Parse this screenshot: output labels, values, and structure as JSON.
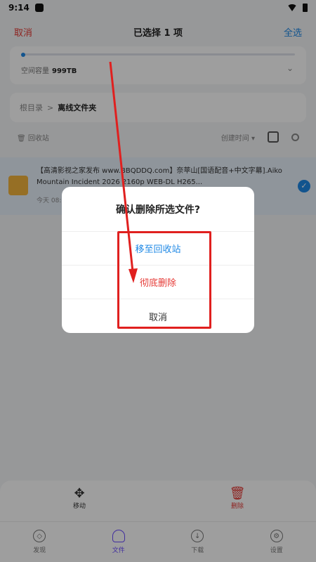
{
  "status": {
    "time": "9:14"
  },
  "topbar": {
    "cancel": "取消",
    "title": "已选择 1 项",
    "select_all": "全选"
  },
  "storage": {
    "label": "空间容量",
    "value": "999TB",
    "progress_percent": 1
  },
  "breadcrumb": {
    "root": "根目录",
    "separator": ">",
    "current": "离线文件夹"
  },
  "toolbar": {
    "recycle": "回收站",
    "sort": "创建时间"
  },
  "file": {
    "name": "【高清影视之家发布 www.BBQDDQ.com】奈苹山[国语配音+中文字幕].Aiko Mountain Incident 2026 2160p WEB-DL H265...",
    "meta": "今天 08:"
  },
  "actions": {
    "move": "移动",
    "delete": "删除"
  },
  "nav": [
    {
      "label": "发现",
      "icon": "compass-icon"
    },
    {
      "label": "文件",
      "icon": "cloud-icon"
    },
    {
      "label": "下载",
      "icon": "download-icon"
    },
    {
      "label": "设置",
      "icon": "gear-icon"
    }
  ],
  "dialog": {
    "title": "确认删除所选文件?",
    "move_to_recycle": "移至回收站",
    "delete_permanently": "彻底删除",
    "cancel": "取消"
  },
  "colors": {
    "accent": "#1e88e5",
    "danger": "#e53935",
    "nav_active": "#6a4bff"
  }
}
